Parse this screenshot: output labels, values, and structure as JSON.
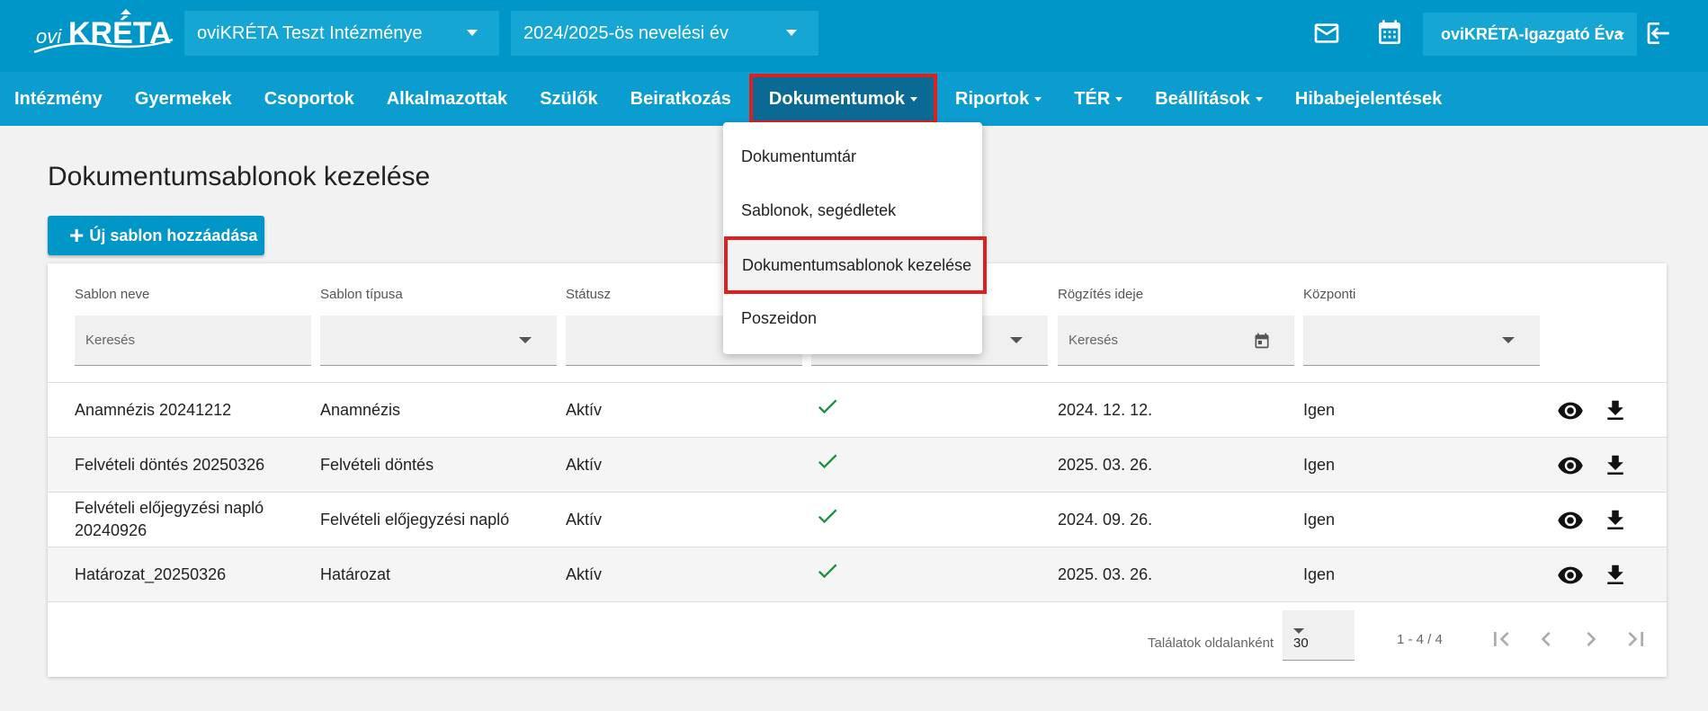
{
  "header": {
    "logo_text": "oviKRÉTA",
    "institution": "oviKRÉTA Teszt Intézménye",
    "school_year": "2024/2025-ös nevelési év",
    "user": "oviKRÉTA-Igazgató Éva",
    "icons": [
      "mail-icon",
      "calendar-icon",
      "logout-icon"
    ]
  },
  "nav": {
    "items": [
      {
        "label": "Intézmény",
        "dropdown": false
      },
      {
        "label": "Gyermekek",
        "dropdown": false
      },
      {
        "label": "Csoportok",
        "dropdown": false
      },
      {
        "label": "Alkalmazottak",
        "dropdown": false
      },
      {
        "label": "Szülők",
        "dropdown": false
      },
      {
        "label": "Beiratkozás",
        "dropdown": false
      },
      {
        "label": "Dokumentumok",
        "dropdown": true,
        "active": true
      },
      {
        "label": "Riportok",
        "dropdown": true
      },
      {
        "label": "TÉR",
        "dropdown": true
      },
      {
        "label": "Beállítások",
        "dropdown": true
      },
      {
        "label": "Hibabejelentések",
        "dropdown": false
      }
    ]
  },
  "dropdown": {
    "items": [
      {
        "label": "Dokumentumtár"
      },
      {
        "label": "Sablonok, segédletek"
      },
      {
        "label": "Dokumentumsablonok kezelése",
        "highlighted": true
      },
      {
        "label": "Poszeidon"
      }
    ]
  },
  "main": {
    "title": "Dokumentumsablonok kezelése",
    "add_button": "Új sablon hozzáadása"
  },
  "table": {
    "headers": [
      "Sablon neve",
      "Sablon típusa",
      "Státusz",
      "",
      "Rögzítés ideje",
      "Központi"
    ],
    "filters": {
      "name_placeholder": "Keresés",
      "date_placeholder": "Keresés"
    },
    "rows": [
      {
        "name": "Anamnézis 20241212",
        "type": "Anamnézis",
        "status": "Aktív",
        "checked": true,
        "date": "2024. 12. 12.",
        "central": "Igen"
      },
      {
        "name": "Felvételi döntés 20250326",
        "type": "Felvételi döntés",
        "status": "Aktív",
        "checked": true,
        "date": "2025. 03. 26.",
        "central": "Igen"
      },
      {
        "name": "Felvételi előjegyzési napló 20240926",
        "type": "Felvételi előjegyzési napló",
        "status": "Aktív",
        "checked": true,
        "date": "2024. 09. 26.",
        "central": "Igen"
      },
      {
        "name": "Határozat_20250326",
        "type": "Határozat",
        "status": "Aktív",
        "checked": true,
        "date": "2025. 03. 26.",
        "central": "Igen"
      }
    ]
  },
  "pagination": {
    "per_page_label": "Találatok oldalanként",
    "per_page": "30",
    "range": "1 - 4 / 4"
  }
}
